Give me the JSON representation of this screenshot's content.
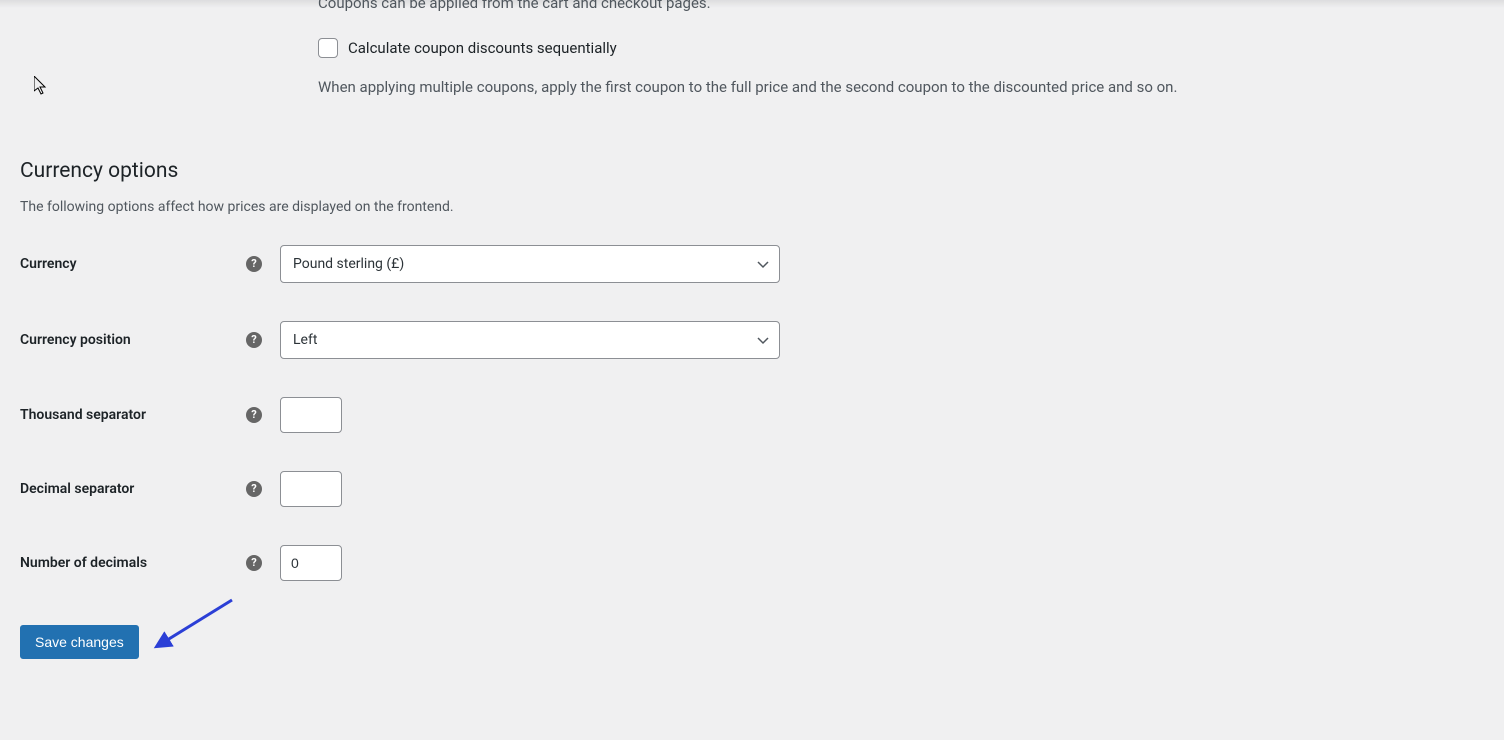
{
  "coupons": {
    "help_text": "Coupons can be applied from the cart and checkout pages.",
    "checkbox_label": "Calculate coupon discounts sequentially",
    "description": "When applying multiple coupons, apply the first coupon to the full price and the second coupon to the discounted price and so on."
  },
  "currency_section": {
    "heading": "Currency options",
    "description": "The following options affect how prices are displayed on the frontend."
  },
  "fields": {
    "currency": {
      "label": "Currency",
      "value": "Pound sterling (£)"
    },
    "currency_position": {
      "label": "Currency position",
      "value": "Left"
    },
    "thousand_separator": {
      "label": "Thousand separator",
      "value": ""
    },
    "decimal_separator": {
      "label": "Decimal separator",
      "value": ""
    },
    "number_of_decimals": {
      "label": "Number of decimals",
      "value": "0"
    }
  },
  "save_button_label": "Save changes"
}
